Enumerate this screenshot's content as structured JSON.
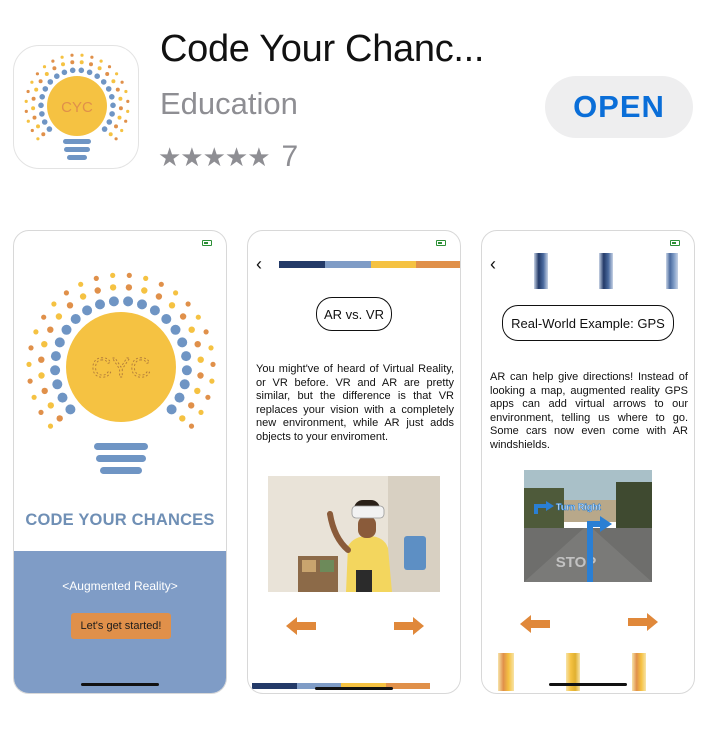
{
  "app": {
    "title": "Code Your Chanc...",
    "category": "Education",
    "stars": "★★★★★",
    "rating_count": "7",
    "open_label": "OPEN",
    "icon_text": "CYC"
  },
  "screenshots": [
    {
      "bulb_text": "CYC",
      "title": "CODE YOUR CHANCES",
      "subtitle": "<Augmented Reality>",
      "button": "Let's get started!"
    },
    {
      "back": "‹",
      "heading": "AR vs. VR",
      "paragraph": "You might've of heard of Virtual Reality, or VR before. VR and AR are pretty similar, but the difference is that VR replaces your vision with a completely new environment, while AR just adds objects to your enviroment."
    },
    {
      "back": "‹",
      "heading": "Real-World Example: GPS",
      "paragraph": "AR can help give directions! Instead of looking a map, augmented reality GPS apps can add virtual arrows to our environment, telling us where to go. Some cars now even come with AR windshields.",
      "photo_sign": "Turn Right",
      "photo_road": "STOP"
    }
  ],
  "colors": {
    "accent_blue": "#0a6ed8",
    "bulb_yellow": "#f5c242",
    "dot_orange": "#e0904a",
    "dot_blue": "#6f95c4",
    "panel_blue": "#7f9cc6",
    "arrow_orange": "#e0883a"
  }
}
